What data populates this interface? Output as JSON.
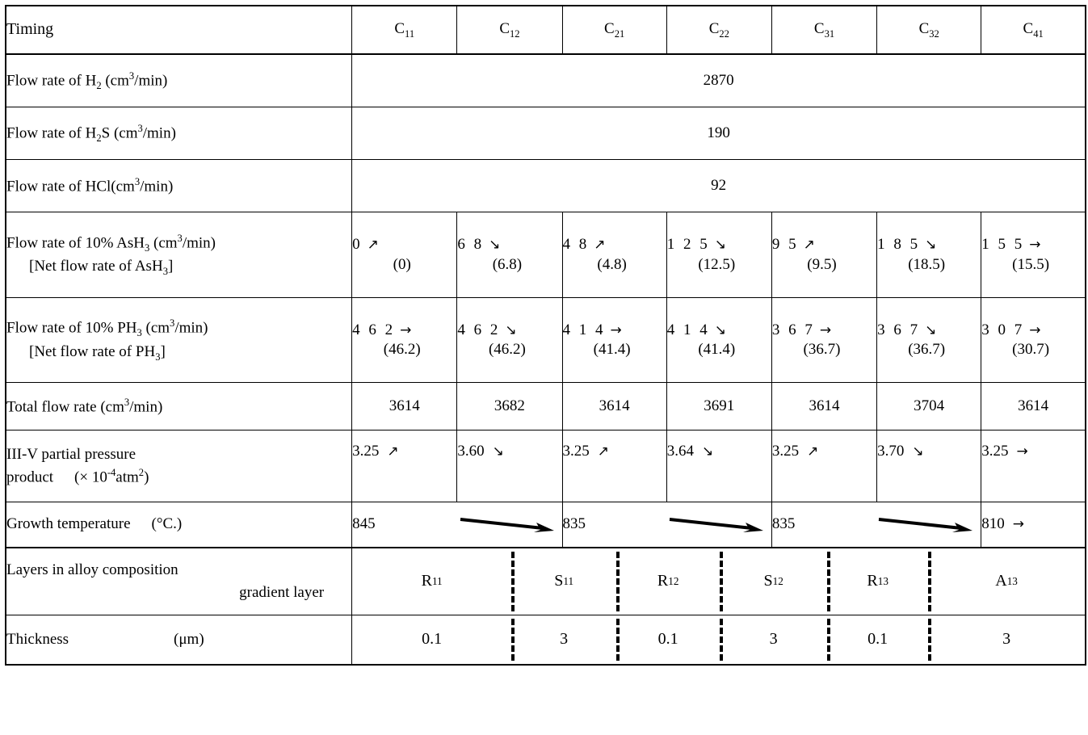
{
  "table": {
    "columns": [
      {
        "label": "C",
        "sub": "11"
      },
      {
        "label": "C",
        "sub": "12"
      },
      {
        "label": "C",
        "sub": "21"
      },
      {
        "label": "C",
        "sub": "22"
      },
      {
        "label": "C",
        "sub": "31"
      },
      {
        "label": "C",
        "sub": "32"
      },
      {
        "label": "C",
        "sub": "41"
      }
    ],
    "header_label": "Timing",
    "rows": {
      "h2": {
        "label_pre": "Flow rate of H",
        "label_sub": "2",
        "label_post": " (cm",
        "label_sup": "3",
        "label_end": "/min)",
        "merged_value": "2870"
      },
      "h2s": {
        "label_pre": "Flow rate of H",
        "label_sub": "2",
        "label_mid": "S",
        "label_post": " (cm",
        "label_sup": "3",
        "label_end": "/min)",
        "merged_value": "190"
      },
      "hcl": {
        "label_pre": "Flow rate of HCl",
        "label_post": "(cm",
        "label_sup": "3",
        "label_end": "/min)",
        "merged_value": "92"
      },
      "ash3": {
        "label_line1_pre": "Flow rate of 10% AsH",
        "label_line1_sub": "3",
        "label_line1_post": " (cm",
        "label_line1_sup": "3",
        "label_line1_end": "/min)",
        "label_line2_pre": "[Net flow rate of AsH",
        "label_line2_sub": "3",
        "label_line2_end": "]",
        "values": [
          {
            "top": "0",
            "arrow": "↗",
            "bottom": "(0)"
          },
          {
            "top": "6 8",
            "arrow": "↘",
            "bottom": "(6.8)"
          },
          {
            "top": "4 8",
            "arrow": "↗",
            "bottom": "(4.8)"
          },
          {
            "top": "1 2 5",
            "arrow": "↘",
            "bottom": "(12.5)"
          },
          {
            "top": "9 5",
            "arrow": "↗",
            "bottom": "(9.5)"
          },
          {
            "top": "1 8 5",
            "arrow": "↘",
            "bottom": "(18.5)"
          },
          {
            "top": "1 5 5",
            "arrow": "→",
            "bottom": "(15.5)"
          }
        ]
      },
      "ph3": {
        "label_line1_pre": "Flow rate of 10% PH",
        "label_line1_sub": "3",
        "label_line1_post": " (cm",
        "label_line1_sup": "3",
        "label_line1_end": "/min)",
        "label_line2_pre": "[Net flow rate of PH",
        "label_line2_sub": "3",
        "label_line2_end": "]",
        "values": [
          {
            "top": "4 6 2",
            "arrow": "→",
            "bottom": "(46.2)"
          },
          {
            "top": "4 6 2",
            "arrow": "↘",
            "bottom": "(46.2)"
          },
          {
            "top": "4 1 4",
            "arrow": "→",
            "bottom": "(41.4)"
          },
          {
            "top": "4 1 4",
            "arrow": "↘",
            "bottom": "(41.4)"
          },
          {
            "top": "3 6 7",
            "arrow": "→",
            "bottom": "(36.7)"
          },
          {
            "top": "3 6 7",
            "arrow": "↘",
            "bottom": "(36.7)"
          },
          {
            "top": "3 0 7",
            "arrow": "→",
            "bottom": "(30.7)"
          }
        ]
      },
      "total": {
        "label_pre": "Total flow rate (cm",
        "label_sup": "3",
        "label_end": "/min)",
        "values": [
          "3614",
          "3682",
          "3614",
          "3691",
          "3614",
          "3704",
          "3614"
        ]
      },
      "partial_pressure": {
        "label_line1": "III-V partial pressure",
        "label_line2_pre": "product",
        "label_line2_mid": "(× 10",
        "label_line2_sup": "-4",
        "label_line2_post": "atm",
        "label_line2_sup2": "2",
        "label_line2_end": ")",
        "values": [
          {
            "val": "3.25",
            "arrow": "↗"
          },
          {
            "val": "3.60",
            "arrow": "↘"
          },
          {
            "val": "3.25",
            "arrow": "↗"
          },
          {
            "val": "3.64",
            "arrow": "↘"
          },
          {
            "val": "3.25",
            "arrow": "↗"
          },
          {
            "val": "3.70",
            "arrow": "↘"
          },
          {
            "val": "3.25",
            "arrow": "→"
          }
        ]
      },
      "growth_temp": {
        "label_pre": "Growth temperature",
        "label_unit": "(°C.)",
        "cells": [
          {
            "value": "845",
            "long_arrow": true
          },
          {
            "value": "835",
            "long_arrow": true
          },
          {
            "value": "835",
            "long_arrow": true
          },
          {
            "value": "810",
            "arrow": "→",
            "long_arrow": false
          }
        ]
      },
      "layers": {
        "label_line1": "Layers in alloy composition",
        "label_line2": "gradient layer",
        "values": [
          {
            "label": "R",
            "sub": "11"
          },
          {
            "label": "S",
            "sub": "11"
          },
          {
            "label": "R",
            "sub": "12"
          },
          {
            "label": "S",
            "sub": "12"
          },
          {
            "label": "R",
            "sub": "13"
          },
          {
            "label": "A",
            "sub": "13"
          }
        ]
      },
      "thickness": {
        "label_pre": "Thickness",
        "label_unit": "(μm)",
        "values": [
          "0.1",
          "3",
          "0.1",
          "3",
          "0.1",
          "3"
        ]
      }
    }
  },
  "colors": {
    "border": "#000000",
    "background": "#ffffff",
    "text": "#000000"
  }
}
